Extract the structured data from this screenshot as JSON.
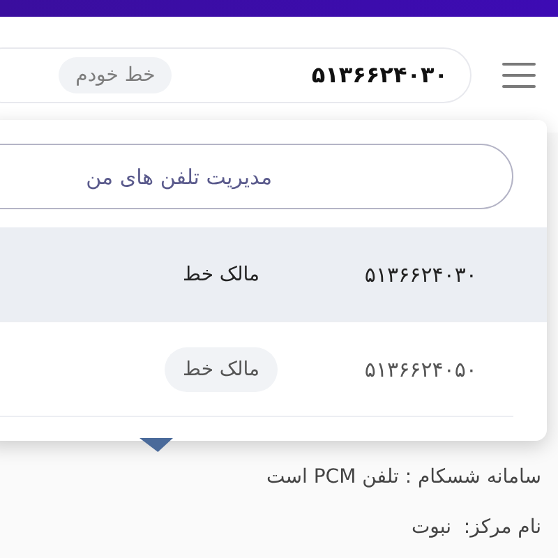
{
  "header": {
    "phone_number": "۵۱۳۶۶۲۴۰۳۰",
    "badge": "خط خودم"
  },
  "dropdown": {
    "manage_button": "مدیریت تلفن های من",
    "lines": [
      {
        "number": "۵۱۳۶۶۲۴۰۳۰",
        "role": "مالک خط",
        "selected": true
      },
      {
        "number": "۵۱۳۶۶۲۴۰۵۰",
        "role": "مالک خط",
        "selected": false
      }
    ]
  },
  "info": [
    "سامانه شسکام : تلفن PCM است",
    "نام مرکز:  نبوت"
  ]
}
